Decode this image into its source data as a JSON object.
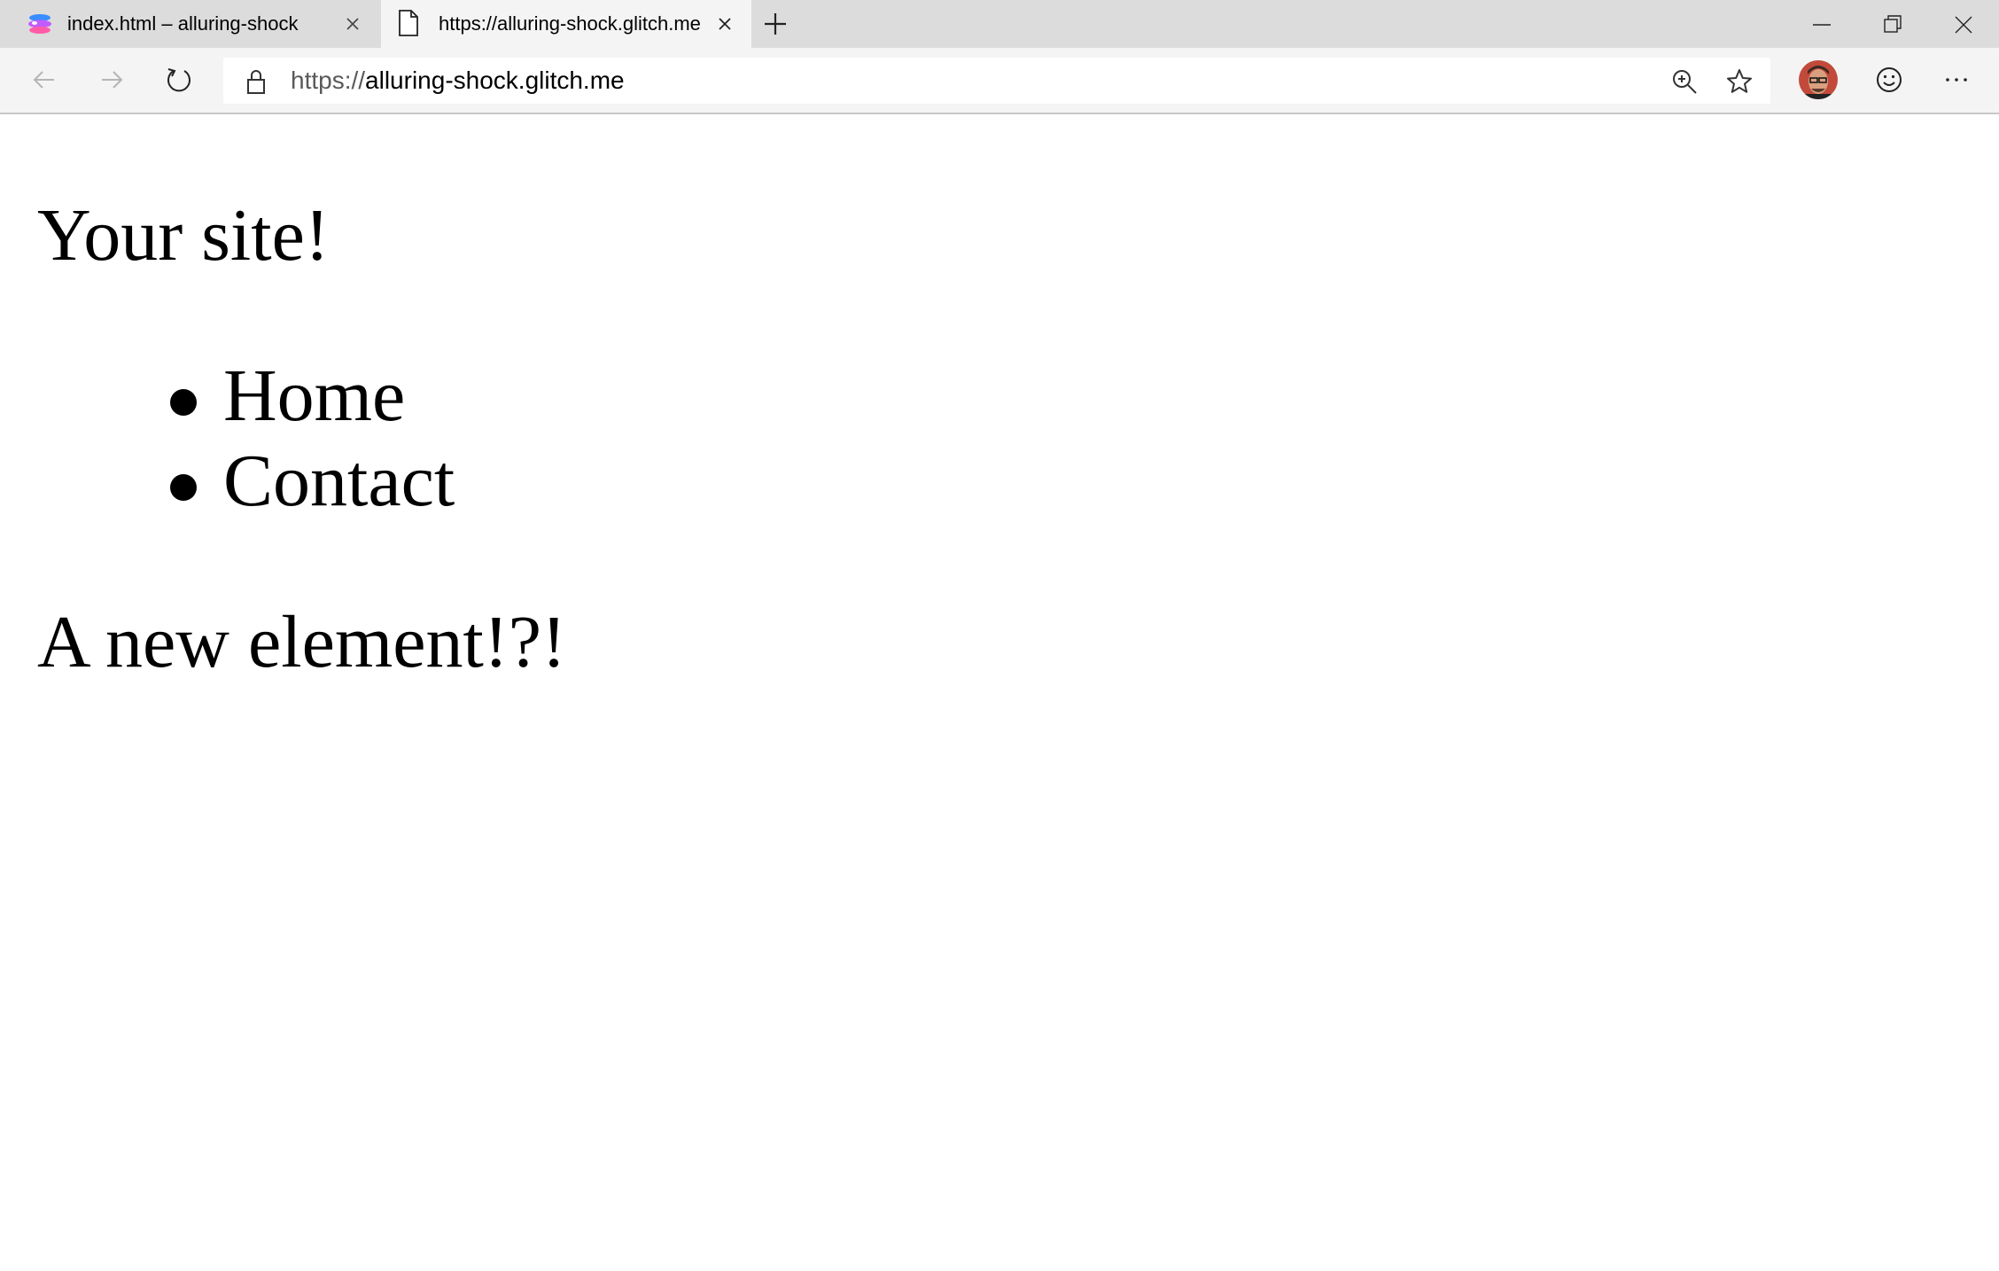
{
  "browser": {
    "tabs": [
      {
        "label": "index.html – alluring-shock",
        "icon": "glitch-logo-icon",
        "active": false
      },
      {
        "label": "https://alluring-shock.glitch.me",
        "icon": "page-icon",
        "active": true
      }
    ],
    "address_bar": {
      "scheme": "https://",
      "host": "alluring-shock.glitch.me"
    },
    "icons": {
      "back": "back-arrow-icon",
      "forward": "forward-arrow-icon",
      "refresh": "refresh-icon",
      "lock": "lock-icon",
      "zoom": "zoom-in-icon",
      "favorite": "star-icon",
      "feedback": "smiley-icon",
      "menu": "more-icon"
    }
  },
  "page": {
    "heading": "Your site!",
    "nav_items": [
      "Home",
      "Contact"
    ],
    "paragraph": "A new element!?!"
  }
}
